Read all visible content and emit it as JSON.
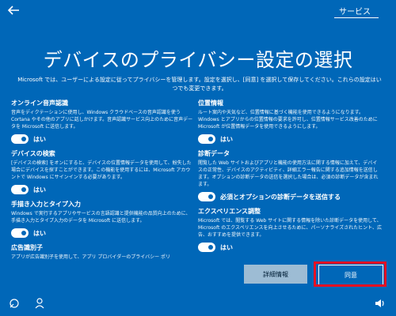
{
  "top": {
    "service_tab": "サービス"
  },
  "title": "デバイスのプライバシー設定の選択",
  "intro": "Microsoft では、ユーザーによる設定に従ってプライバシーを管理します。設定を選択し、[同意] を選択して保存してください。これらの設定はいつでも変更できます。",
  "left": [
    {
      "title": "オンライン音声認識",
      "desc": "音声をディクテーションに使用し、Windows クラウドベースの音声認識を使う Cortana やその他のアプリに話しかけます。音声認識サービス向上のために音声データを Microsoft に送信します。",
      "toggle_label": "はい"
    },
    {
      "title": "デバイスの検索",
      "desc": "[デバイスの検索] をオンにすると、デバイスの位置情報データを使用して、紛失した場合にデバイスを探すことができます。この機能を使用するには、Microsoft アカウントで Windows にサインインする必要があります。",
      "toggle_label": "はい"
    },
    {
      "title": "手描き入力とタイプ入力",
      "desc": "Windows で実行するアプリやサービスの言語認識と提供機能の品質向上のために、手描き入力とタイプ入力のデータを Microsoft に送信します。",
      "toggle_label": "はい"
    },
    {
      "title": "広告識別子",
      "desc": "アプリが広告識別子を使用して、アプリ プロバイダーのプライバシー ポリ"
    }
  ],
  "right": [
    {
      "title": "位置情報",
      "desc": "ルート案内や天気など、位置情報に基づく機能を使用できるようになります。Windows とアプリからの位置情報の要求を許可し、位置情報サービス改善のために Microsoft が位置情報データを使用できるようにします。",
      "toggle_label": "はい"
    },
    {
      "title": "診断データ",
      "desc": "閲覧した Web サイトおよびアプリと機能の使用方法に関する情報に加えて、デバイスの正常性、デバイスのアクティビティ、詳細エラー報告に関する追加情報を送信します。オプションの診断データの送信を選択した場合は、必須の診断データが含まれます。",
      "toggle_label": "必須とオプションの診断データを送信する"
    },
    {
      "title": "エクスペリエンス調整",
      "desc": "Microsoft では、閲覧する Web サイトに関する情報を除いた診断データを使用して、Microsoft のエクスペリエンスを向上させるために、パーソナライズされたヒント、広告、おすすめを提供できます。",
      "toggle_label": "はい"
    }
  ],
  "buttons": {
    "details": "詳細情報",
    "accept": "同意"
  },
  "icons": {
    "back": "back-arrow-icon",
    "ease": "ease-of-access-icon",
    "ime": "input-method-icon",
    "volume": "volume-icon"
  }
}
